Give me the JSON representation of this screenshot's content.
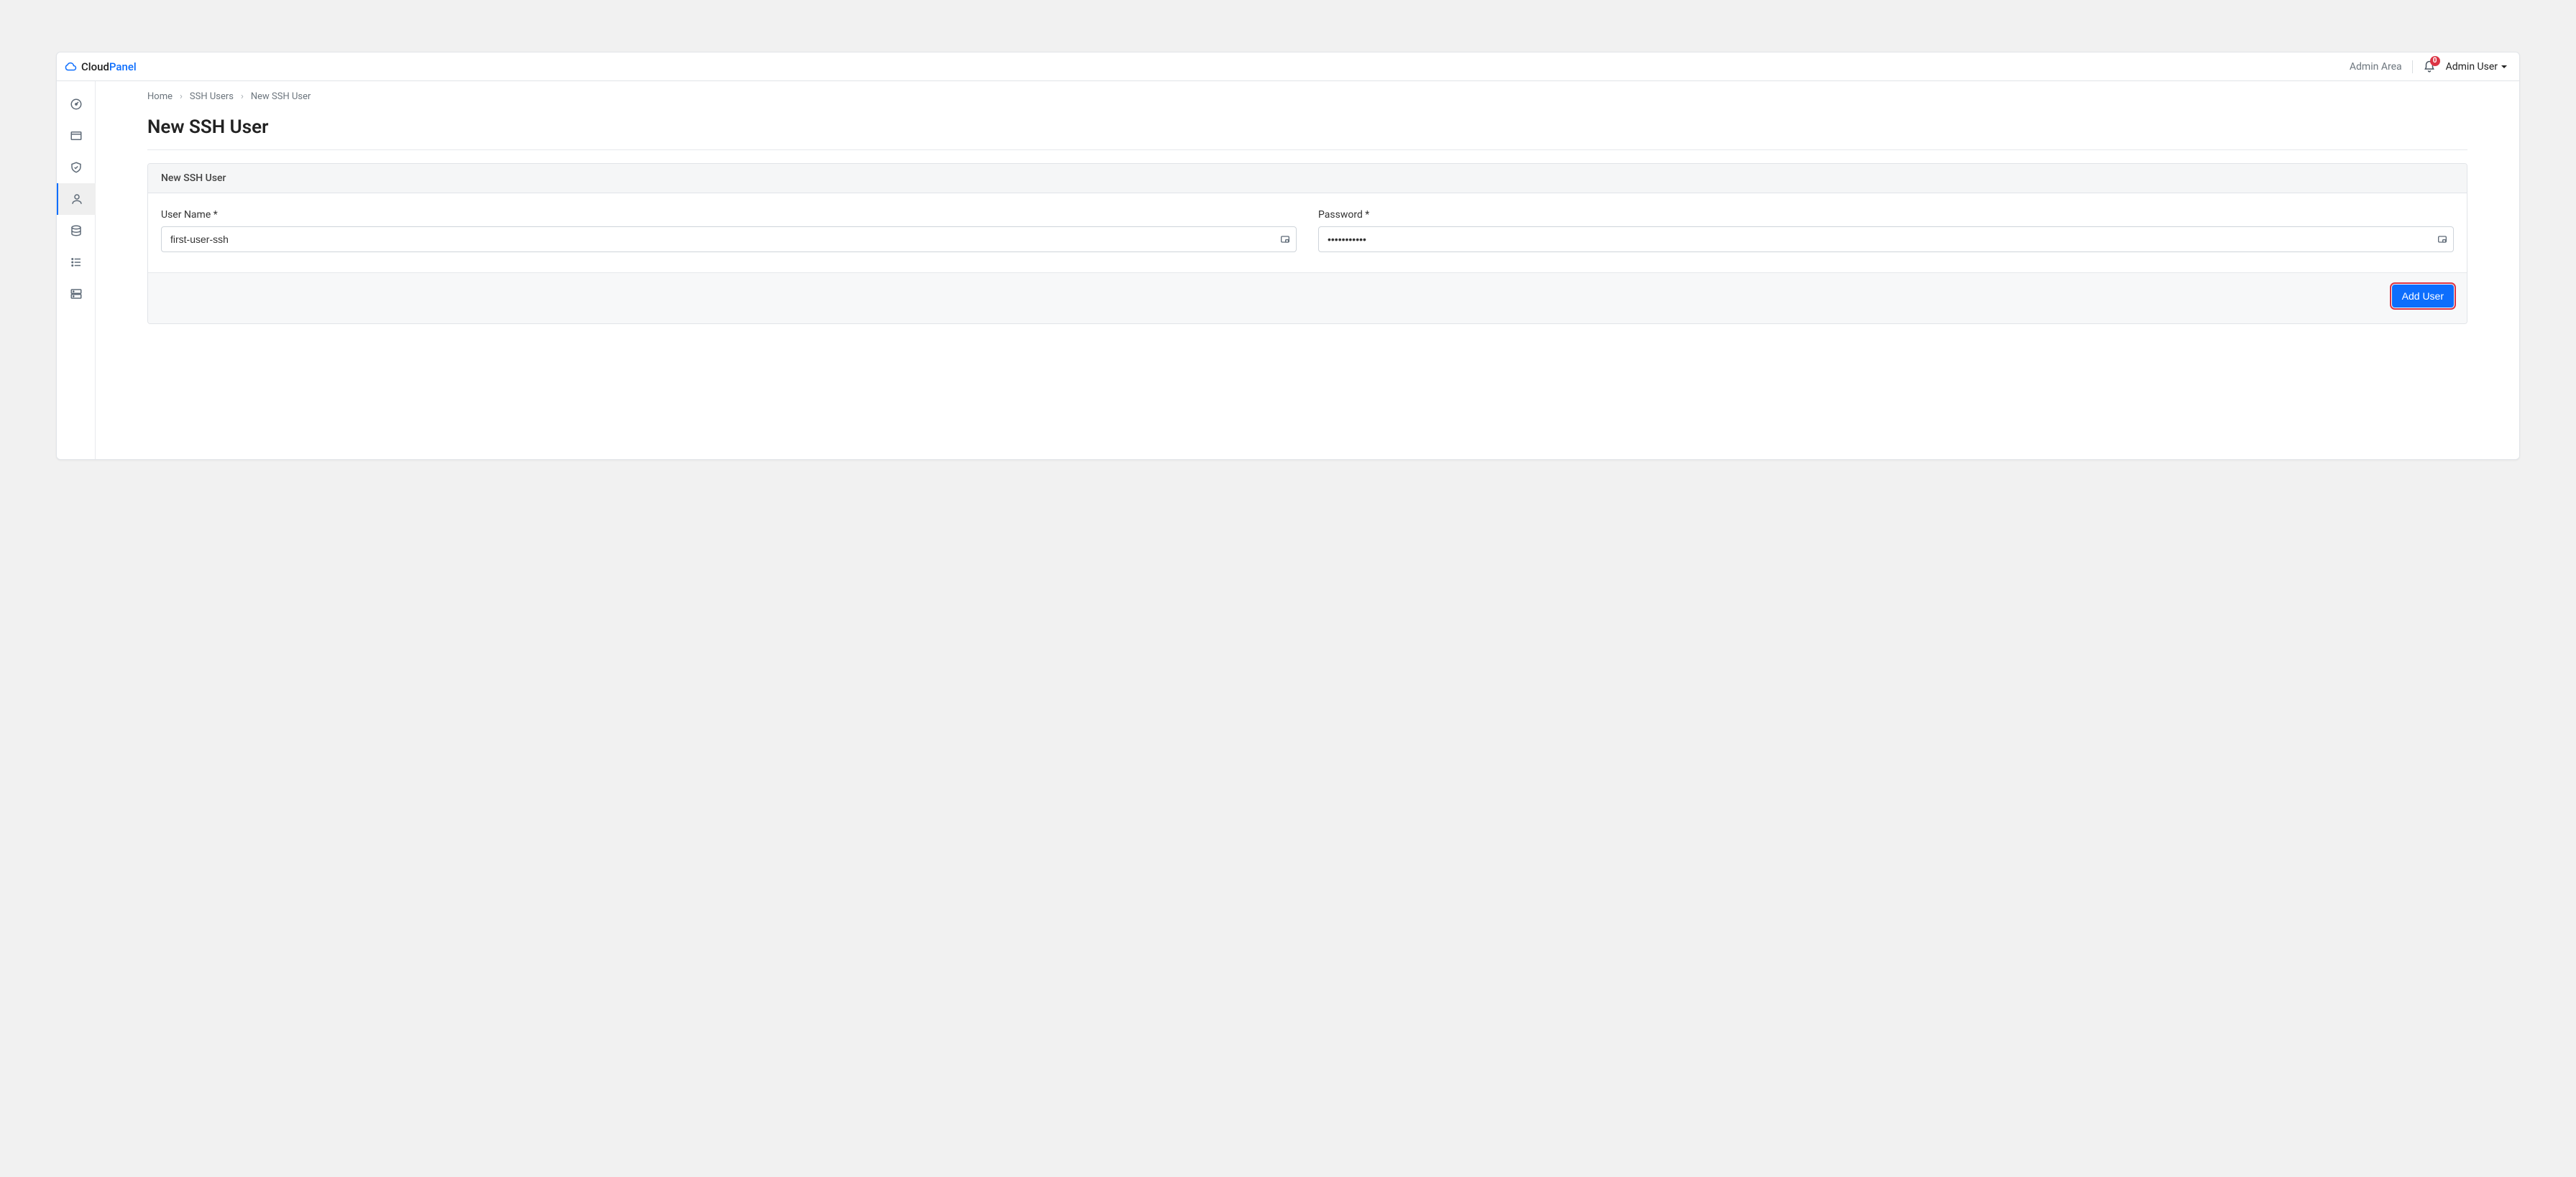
{
  "brand": {
    "first": "Cloud",
    "second": "Panel"
  },
  "header": {
    "admin_area": "Admin Area",
    "notifications_count": "0",
    "user_label": "Admin User"
  },
  "breadcrumb": {
    "home": "Home",
    "ssh_users": "SSH Users",
    "current": "New SSH User"
  },
  "page_title": "New SSH User",
  "card": {
    "title": "New SSH User",
    "username_label": "User Name *",
    "username_value": "first-user-ssh",
    "password_label": "Password *",
    "password_value": "•••••••••••",
    "submit_label": "Add User"
  },
  "sidebar": {
    "items": [
      {
        "name": "dashboard"
      },
      {
        "name": "sites"
      },
      {
        "name": "security"
      },
      {
        "name": "users"
      },
      {
        "name": "databases"
      },
      {
        "name": "cron"
      },
      {
        "name": "servers"
      }
    ],
    "active_index": 3
  }
}
